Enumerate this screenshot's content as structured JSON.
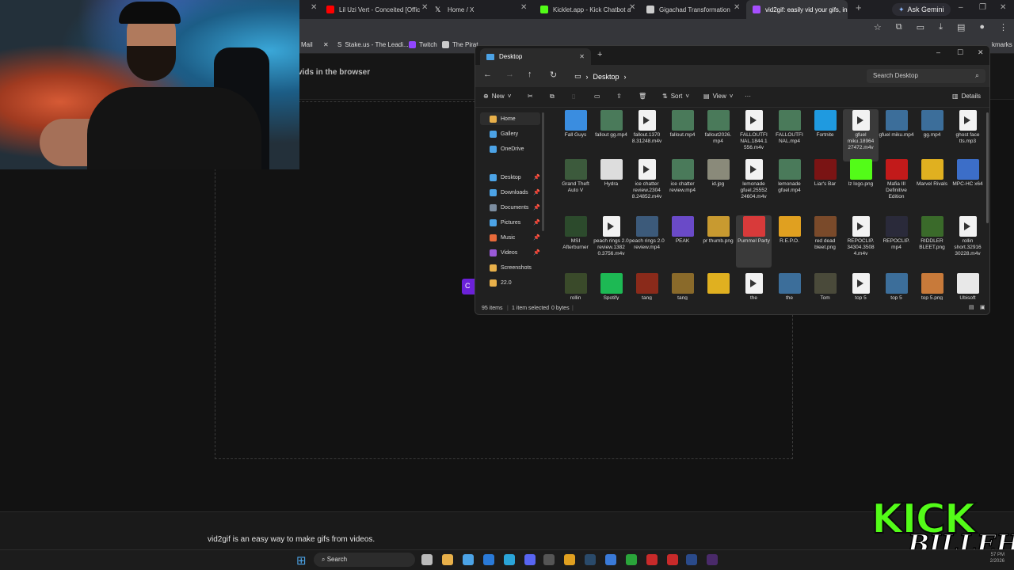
{
  "browser": {
    "tabs": [
      {
        "title": "Lil Uzi Vert - Conceited [Offici",
        "color": "#ff0000"
      },
      {
        "title": "Home / X",
        "color": "#ffffff"
      },
      {
        "title": "Kicklet.app - Kick Chatbot an",
        "color": "#53fc18"
      },
      {
        "title": "Gigachad Transformation Gui",
        "color": "#cccccc"
      },
      {
        "title": "vid2gif: easily vid your gifs, in",
        "color": "#a64fff"
      }
    ],
    "gemini_label": "Ask Gemini",
    "bookmarks": [
      {
        "label": "Mail",
        "color": "#ea4335"
      },
      {
        "label": "",
        "color": "#ffffff"
      },
      {
        "label": "Stake.us - The Leadi...",
        "color": "#ffffff"
      },
      {
        "label": "Twitch",
        "color": "#9146ff"
      },
      {
        "label": "The Pirat",
        "color": "#cccccc"
      },
      {
        "label": "kmarks",
        "color": "#cccccc"
      }
    ]
  },
  "page": {
    "headline": "vids in the browser",
    "button_label": "C",
    "footer_text": "vid2gif is an easy way to make gifs from videos."
  },
  "explorer": {
    "tab_title": "Desktop",
    "breadcrumb": "Desktop",
    "search_placeholder": "Search Desktop",
    "commands": {
      "new": "New",
      "sort": "Sort",
      "view": "View",
      "more": "···",
      "details": "Details"
    },
    "sidebar": [
      {
        "label": "Home",
        "color": "#e8b04a",
        "selected": true,
        "pinned": false
      },
      {
        "label": "Gallery",
        "color": "#4ca3e6",
        "selected": false,
        "pinned": false
      },
      {
        "label": "OneDrive",
        "color": "#4ca3e6",
        "selected": false,
        "pinned": false
      },
      {
        "label": "Desktop",
        "color": "#4ca3e6",
        "selected": false,
        "pinned": true
      },
      {
        "label": "Downloads",
        "color": "#4ca3e6",
        "selected": false,
        "pinned": true
      },
      {
        "label": "Documents",
        "color": "#7c8da0",
        "selected": false,
        "pinned": true
      },
      {
        "label": "Pictures",
        "color": "#4ca3e6",
        "selected": false,
        "pinned": true
      },
      {
        "label": "Music",
        "color": "#e86a3a",
        "selected": false,
        "pinned": true
      },
      {
        "label": "Videos",
        "color": "#9a5ad8",
        "selected": false,
        "pinned": true
      },
      {
        "label": "Screenshots",
        "color": "#e8b04a",
        "selected": false,
        "pinned": false
      },
      {
        "label": "22.0",
        "color": "#e8b04a",
        "selected": false,
        "pinned": false
      }
    ],
    "files": [
      [
        {
          "name": "Fall Guys",
          "kind": "img",
          "color": "#3a8de0"
        },
        {
          "name": "fallout gg.mp4",
          "kind": "img",
          "color": "#4a7a5a"
        },
        {
          "name": "fallout.1370 8.31248.m4v",
          "kind": "doc",
          "color": "#f2f2f2"
        },
        {
          "name": "fallout.mp4",
          "kind": "img",
          "color": "#4a7a5a"
        },
        {
          "name": "fallout2026. mp4",
          "kind": "img",
          "color": "#4a7a5a"
        },
        {
          "name": "FALLOUTFI NAL.1844.1 556.m4v",
          "kind": "doc",
          "color": "#f2f2f2"
        },
        {
          "name": "FALLOUTFI NAL.mp4",
          "kind": "img",
          "color": "#4a7a5a"
        },
        {
          "name": "Fortnite",
          "kind": "img",
          "color": "#1f9ae0"
        },
        {
          "name": "gfuel miku.18964 27472.m4v",
          "kind": "doc",
          "color": "#f2f2f2",
          "selected": true
        },
        {
          "name": "gfuel miku.mp4",
          "kind": "img",
          "color": "#3c6e9a"
        },
        {
          "name": "gg.mp4",
          "kind": "img",
          "color": "#3c6e9a"
        },
        {
          "name": "ghost face tts.mp3",
          "kind": "doc",
          "color": "#f2f2f2"
        }
      ],
      [
        {
          "name": "Grand Theft Auto V",
          "kind": "img",
          "color": "#3c5a3c"
        },
        {
          "name": "Hydra",
          "kind": "img",
          "color": "#dddddd"
        },
        {
          "name": "ice chatter review.2304 8.24852.m4v",
          "kind": "doc",
          "color": "#f2f2f2"
        },
        {
          "name": "ice chatter review.mp4",
          "kind": "img",
          "color": "#4a7a5a"
        },
        {
          "name": "id.jpg",
          "kind": "img",
          "color": "#8a8a7a"
        },
        {
          "name": "lemonade gfuel.25552 24604.m4v",
          "kind": "doc",
          "color": "#f2f2f2"
        },
        {
          "name": "lemonade gfuel.mp4",
          "kind": "img",
          "color": "#4a7a5a"
        },
        {
          "name": "Liar's Bar",
          "kind": "img",
          "color": "#7a1414"
        },
        {
          "name": "lz logo.png",
          "kind": "img",
          "color": "#53fc18"
        },
        {
          "name": "Mafia III Definitive Edition",
          "kind": "img",
          "color": "#c21a1a"
        },
        {
          "name": "Marvel Rivals",
          "kind": "img",
          "color": "#e0b020"
        },
        {
          "name": "MPC-HC x64",
          "kind": "img",
          "color": "#3c6ec8"
        }
      ],
      [
        {
          "name": "MSI Afterburner",
          "kind": "img",
          "color": "#2c4a2c"
        },
        {
          "name": "peach rings 2.0 review.1382 0.3756.m4v",
          "kind": "doc",
          "color": "#f2f2f2"
        },
        {
          "name": "peach rings 2.0 review.mp4",
          "kind": "img",
          "color": "#3c5a7a"
        },
        {
          "name": "PEAK",
          "kind": "img",
          "color": "#6a4ac8"
        },
        {
          "name": "pr thumb.png",
          "kind": "img",
          "color": "#c89a30"
        },
        {
          "name": "Pummel Party",
          "kind": "img",
          "color": "#d83a3a",
          "selected": true
        },
        {
          "name": "R.E.P.O.",
          "kind": "img",
          "color": "#e0a020"
        },
        {
          "name": "red dead bleet.png",
          "kind": "img",
          "color": "#7a4a2a"
        },
        {
          "name": "REPOCLIP. 34304.3508 4.m4v",
          "kind": "doc",
          "color": "#f2f2f2"
        },
        {
          "name": "REPOCLIP. mp4",
          "kind": "img",
          "color": "#2a2a3a"
        },
        {
          "name": "RIDDLER BLEET.png",
          "kind": "img",
          "color": "#3a6a2a"
        },
        {
          "name": "rollin short.32916 30228.m4v",
          "kind": "doc",
          "color": "#f2f2f2"
        }
      ],
      [
        {
          "name": "rollin",
          "kind": "img",
          "color": "#3a4a2a"
        },
        {
          "name": "Spotify",
          "kind": "img",
          "color": "#1db954"
        },
        {
          "name": "tang",
          "kind": "img",
          "color": "#8a2a1a"
        },
        {
          "name": "tang",
          "kind": "img",
          "color": "#8a6a2a"
        },
        {
          "name": "",
          "kind": "img",
          "color": "#e0b020"
        },
        {
          "name": "the",
          "kind": "doc",
          "color": "#f2f2f2"
        },
        {
          "name": "the",
          "kind": "img",
          "color": "#3c6e9a"
        },
        {
          "name": "Tom",
          "kind": "img",
          "color": "#4a4a3a"
        },
        {
          "name": "top 5",
          "kind": "doc",
          "color": "#f2f2f2"
        },
        {
          "name": "top 5",
          "kind": "img",
          "color": "#3c6e9a"
        },
        {
          "name": "top 5.png",
          "kind": "img",
          "color": "#c87a3a"
        },
        {
          "name": "Ubisoft",
          "kind": "img",
          "color": "#e8e8e8"
        }
      ]
    ],
    "status": {
      "items": "95 items",
      "selected": "1 item selected",
      "size": "0 bytes"
    }
  },
  "overlay": {
    "kick_word": "KICK",
    "streamer": "BILLEH"
  },
  "taskbar": {
    "search_label": "Search",
    "clock": "57 PM",
    "date": "2/2026",
    "icons": [
      {
        "name": "task-view-icon",
        "color": "#bbbbbb"
      },
      {
        "name": "file-explorer-icon",
        "color": "#e8b04a"
      },
      {
        "name": "store-icon",
        "color": "#4ca3e6"
      },
      {
        "name": "outlook-icon",
        "color": "#2a7ad8"
      },
      {
        "name": "edge-icon",
        "color": "#2aa4d8"
      },
      {
        "name": "discord-icon",
        "color": "#5865f2"
      },
      {
        "name": "excel-icon",
        "color": "#555555"
      },
      {
        "name": "chrome-icon",
        "color": "#e0a020"
      },
      {
        "name": "steam-icon",
        "color": "#2a4a6a"
      },
      {
        "name": "monitor-icon",
        "color": "#3a7ad8"
      },
      {
        "name": "xbox-icon",
        "color": "#2aa43a"
      },
      {
        "name": "app-icon",
        "color": "#c82a2a"
      },
      {
        "name": "record-icon",
        "color": "#c82a2a"
      },
      {
        "name": "photoshop-icon",
        "color": "#2a4a8a"
      },
      {
        "name": "premiere-icon",
        "color": "#4a2a6a"
      }
    ]
  }
}
